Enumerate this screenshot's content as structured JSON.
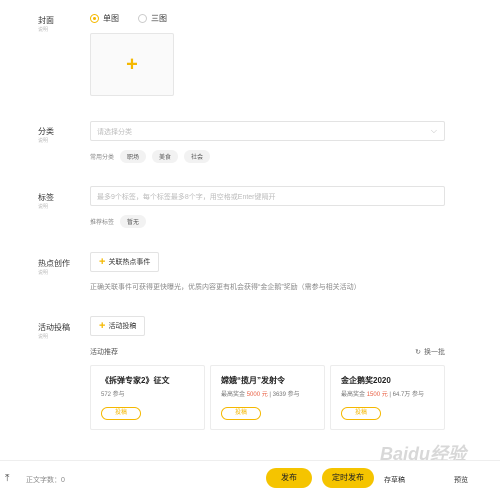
{
  "cover": {
    "label": "封面",
    "sub": "说明",
    "options": [
      "单图",
      "三图"
    ],
    "selected": "单图"
  },
  "category": {
    "label": "分类",
    "sub": "说明",
    "placeholder": "请选择分类",
    "common_label": "常用分类",
    "chips": [
      "职场",
      "美食",
      "社会"
    ]
  },
  "tags": {
    "label": "标签",
    "sub": "说明",
    "placeholder": "最多9个标签，每个标签最多8个字，用空格或Enter键隔开",
    "recommend_label": "推荐标签",
    "recommend_value": "暂无"
  },
  "hot": {
    "label": "热点创作",
    "sub": "说明",
    "button": "关联热点事件",
    "note": "正确关联事件可获得更快曝光，优质内容更有机会获得“金企鹅”奖励（需参与相关活动）"
  },
  "activity": {
    "label": "活动投稿",
    "sub": "说明",
    "button": "活动投稿",
    "recommend_title": "活动推荐",
    "refresh": "换一批",
    "cards": [
      {
        "title": "《拆弹专家2》征文",
        "meta": "572 参与",
        "button": "投稿"
      },
      {
        "title": "嫦娥“揽月”发射令",
        "meta_prefix": "最高奖金",
        "amount": "5000 元",
        "meta_suffix": "| 3639 参与",
        "button": "投稿"
      },
      {
        "title": "金企鹅奖2020",
        "meta_prefix": "最高奖金",
        "amount": "1500 元",
        "meta_suffix": "| 64.7万 参与",
        "button": "投稿"
      }
    ]
  },
  "footer": {
    "word_count": "正文字数：0",
    "publish": "发布",
    "schedule": "定时发布",
    "save_draft": "存草稿",
    "preview": "预览"
  },
  "watermark": "Baidu经验",
  "colors": {
    "accent": "#f5b800",
    "highlight": "#e85c3f"
  }
}
